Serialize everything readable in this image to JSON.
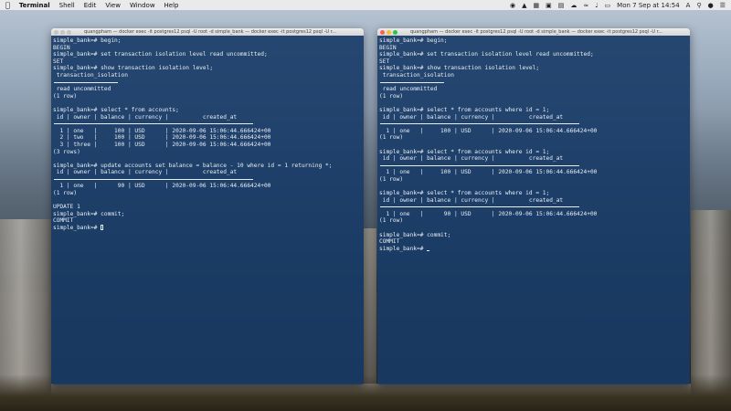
{
  "menubar": {
    "app_name": "Terminal",
    "menus": [
      "Shell",
      "Edit",
      "View",
      "Window",
      "Help"
    ],
    "clock": "Mon 7 Sep at 14:54",
    "input_source": "A"
  },
  "window_left": {
    "title": "quangpham — docker exec -it postgres12 psql -U root -d simple_bank — docker exec -it postgres12 psql -U r...",
    "lines": [
      "simple_bank=# begin;",
      "BEGIN",
      "simple_bank=# set transaction isolation level read uncommitted;",
      "SET",
      "simple_bank=# show transaction isolation level;",
      " transaction_isolation",
      "__RULE_SHORT__",
      " read uncommitted",
      "(1 row)",
      "",
      "simple_bank=# select * from accounts;",
      " id | owner | balance | currency |          created_at",
      "__RULE_WIDE__",
      "  1 | one   |     100 | USD      | 2020-09-06 15:06:44.666424+00",
      "  2 | two   |     100 | USD      | 2020-09-06 15:06:44.666424+00",
      "  3 | three |     100 | USD      | 2020-09-06 15:06:44.666424+00",
      "(3 rows)",
      "",
      "simple_bank=# update accounts set balance = balance - 10 where id = 1 returning *;",
      " id | owner | balance | currency |          created_at",
      "__RULE_WIDE__",
      "  1 | one   |      90 | USD      | 2020-09-06 15:06:44.666424+00",
      "(1 row)",
      "",
      "UPDATE 1",
      "simple_bank=# commit;",
      "COMMIT",
      "simple_bank=# "
    ]
  },
  "window_right": {
    "title": "quangpham — docker exec -it postgres12 psql -U root -d simple_bank — docker exec -it postgres12 psql -U r...",
    "lines": [
      "simple_bank=# begin;",
      "BEGIN",
      "simple_bank=# set transaction isolation level read uncommitted;",
      "SET",
      "simple_bank=# show transaction isolation level;",
      " transaction_isolation",
      "__RULE_SHORT__",
      " read uncommitted",
      "(1 row)",
      "",
      "simple_bank=# select * from accounts where id = 1;",
      " id | owner | balance | currency |          created_at",
      "__RULE_WIDE__",
      "  1 | one   |     100 | USD      | 2020-09-06 15:06:44.666424+00",
      "(1 row)",
      "",
      "simple_bank=# select * from accounts where id = 1;",
      " id | owner | balance | currency |          created_at",
      "__RULE_WIDE__",
      "  1 | one   |     100 | USD      | 2020-09-06 15:06:44.666424+00",
      "(1 row)",
      "",
      "simple_bank=# select * from accounts where id = 1;",
      " id | owner | balance | currency |          created_at",
      "__RULE_WIDE__",
      "  1 | one   |      90 | USD      | 2020-09-06 15:06:44.666424+00",
      "(1 row)",
      "",
      "simple_bank=# commit;",
      "COMMIT",
      "simple_bank=# "
    ]
  }
}
